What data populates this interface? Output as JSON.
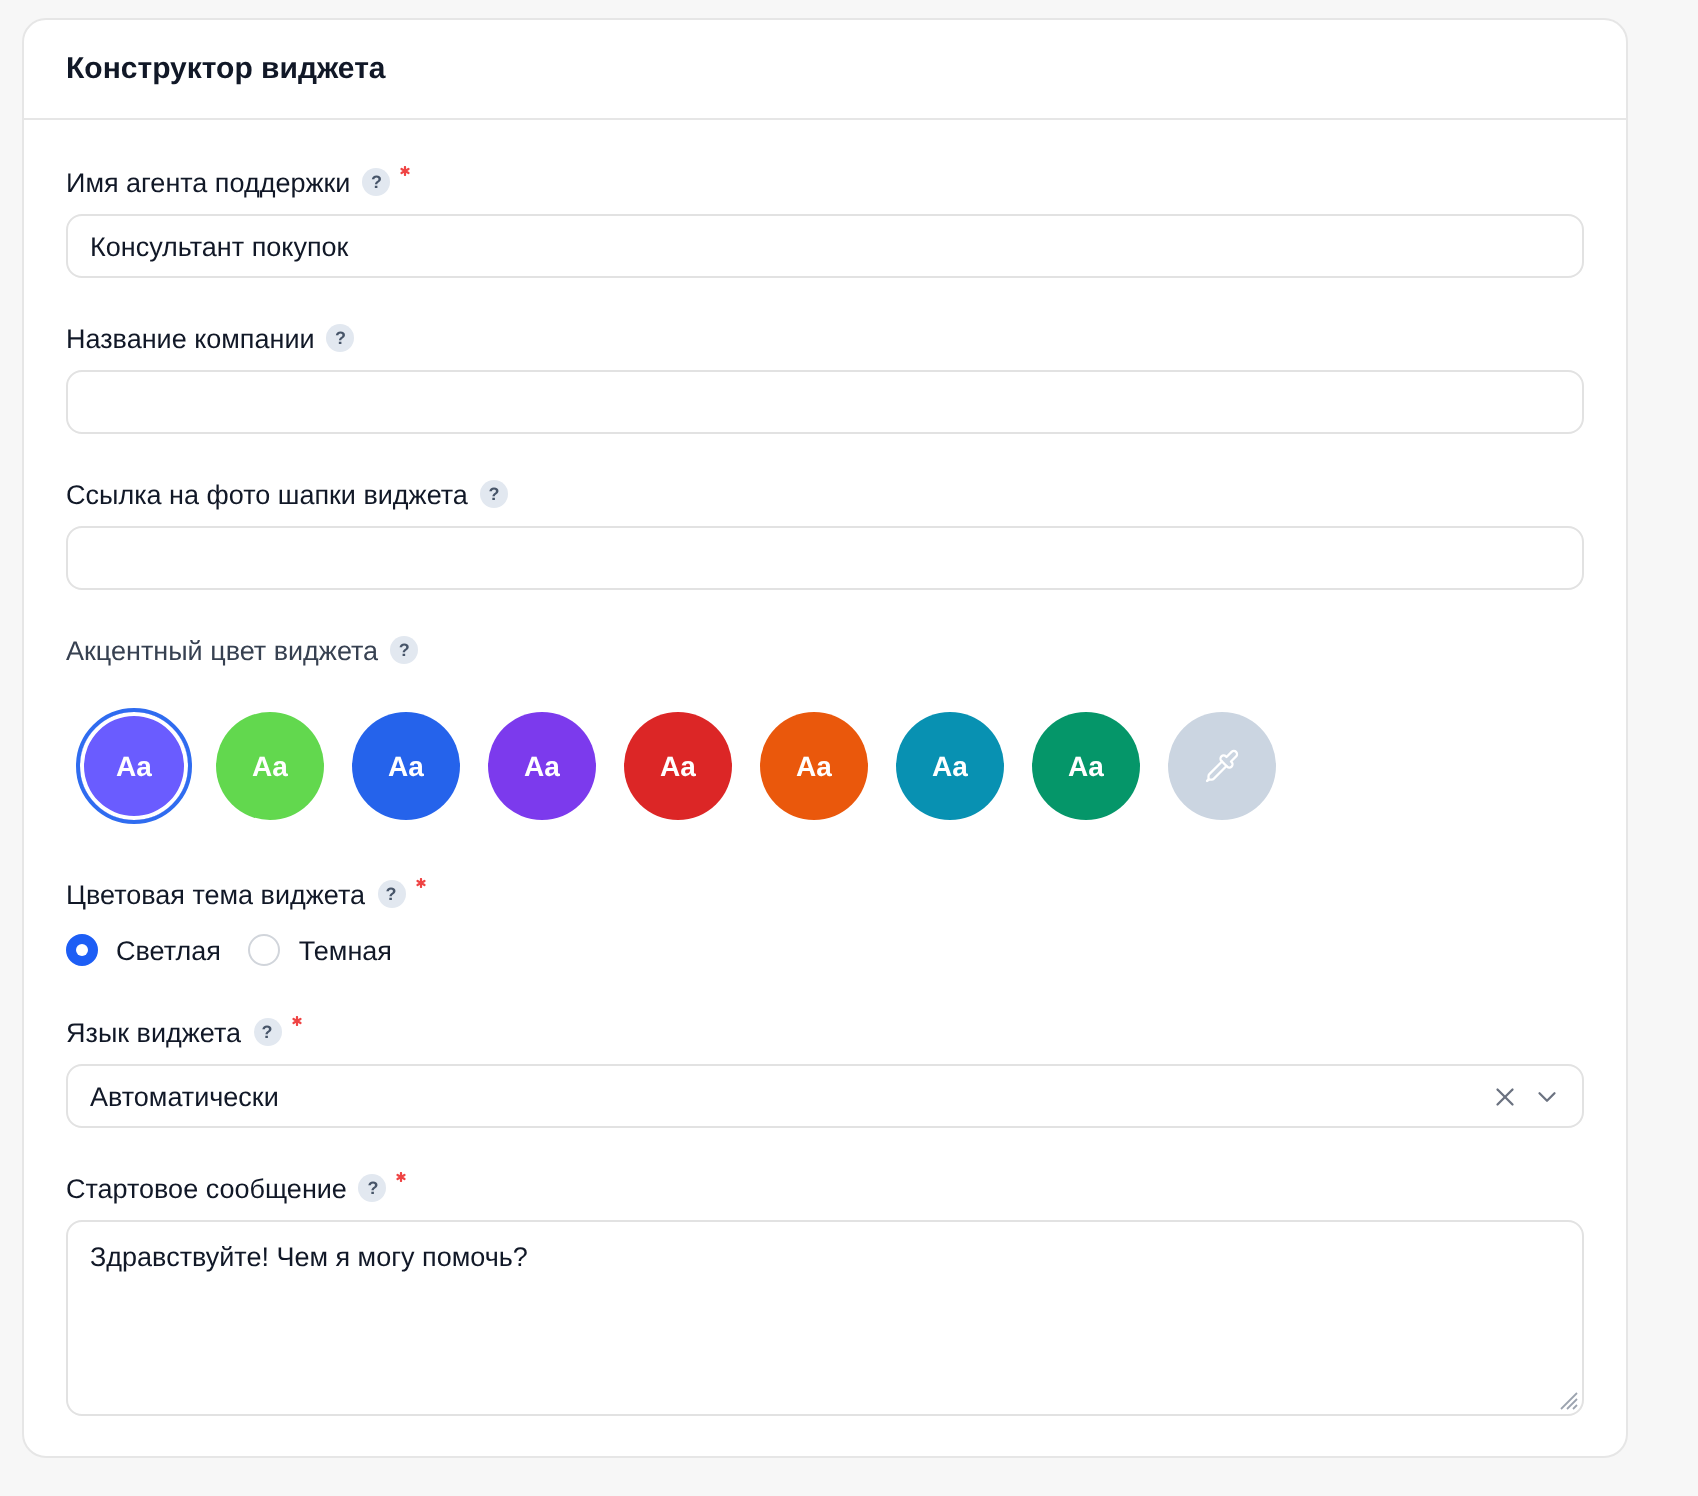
{
  "card": {
    "title": "Конструктор виджета"
  },
  "fields": [
    {
      "kind": "text",
      "label": "Имя агента поддержки",
      "help": "?",
      "required": true,
      "value": "Консультант покупок"
    },
    {
      "kind": "text",
      "label": "Название компании",
      "help": "?",
      "required": false
    },
    {
      "kind": "text",
      "label": "Ссылка на фото шапки виджета",
      "help": "?",
      "required": false
    },
    {
      "kind": "colors",
      "label": "Акцентный цвет виджета",
      "help": "?",
      "required": false,
      "swatches": [
        {
          "kind": "color",
          "text": "Aa",
          "color": "#6a5cff",
          "selected": true
        },
        {
          "kind": "color",
          "text": "Aa",
          "color": "#62d84e",
          "selected": false
        },
        {
          "kind": "color",
          "text": "Aa",
          "color": "#2563eb",
          "selected": false
        },
        {
          "kind": "color",
          "text": "Aa",
          "color": "#7c3aed",
          "selected": false
        },
        {
          "kind": "color",
          "text": "Aa",
          "color": "#dc2626",
          "selected": false
        },
        {
          "kind": "color",
          "text": "Aa",
          "color": "#ea580c",
          "selected": false
        },
        {
          "kind": "color",
          "text": "Aa",
          "color": "#0891b2",
          "selected": false
        },
        {
          "kind": "color",
          "text": "Aa",
          "color": "#059669",
          "selected": false
        },
        {
          "kind": "picker",
          "color": "#cbd5e1",
          "selected": false
        }
      ]
    },
    {
      "kind": "radio",
      "label": "Цветовая тема виджета",
      "help": "?",
      "required": true,
      "options": [
        {
          "label": "Светлая",
          "selected": true
        },
        {
          "label": "Темная",
          "selected": false
        }
      ]
    },
    {
      "kind": "select",
      "label": "Язык виджета",
      "help": "?",
      "required": true,
      "value": "Автоматически",
      "clearable": true
    },
    {
      "kind": "textarea",
      "label": "Стартовое сообщение",
      "help": "?",
      "required": true,
      "value": "Здравствуйте! Чем я могу помочь?"
    }
  ]
}
